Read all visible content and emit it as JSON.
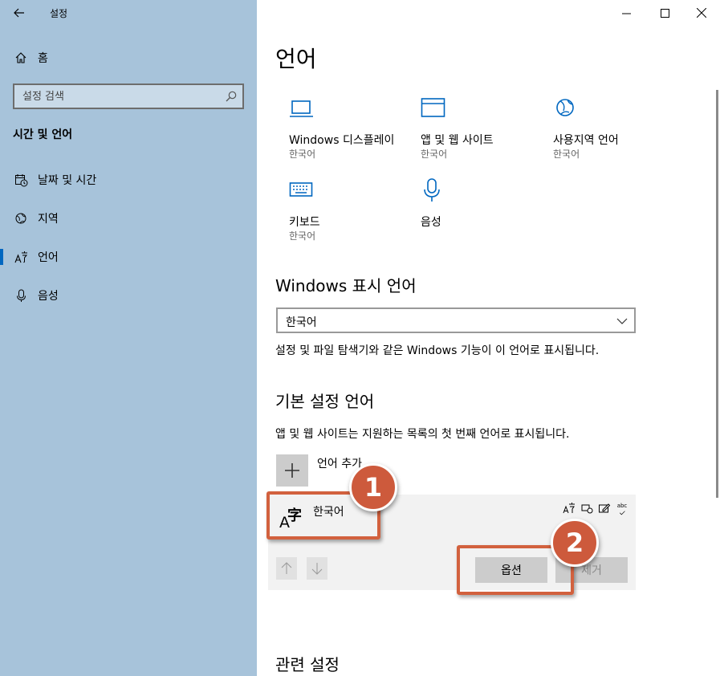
{
  "window": {
    "app_title": "설정"
  },
  "sidebar": {
    "home_label": "홈",
    "search_placeholder": "설정 검색",
    "section_title": "시간 및 언어",
    "items": [
      {
        "label": "날짜 및 시간",
        "icon": "calendar-clock-icon"
      },
      {
        "label": "지역",
        "icon": "globe-pin-icon"
      },
      {
        "label": "언어",
        "icon": "language-icon",
        "active": true
      },
      {
        "label": "음성",
        "icon": "microphone-icon"
      }
    ]
  },
  "main": {
    "title": "언어",
    "tiles": [
      {
        "name": "Windows 디스플레이",
        "sub": "한국어",
        "icon": "laptop-icon"
      },
      {
        "name": "앱 및 웹 사이트",
        "sub": "한국어",
        "icon": "window-icon"
      },
      {
        "name": "사용지역 언어",
        "sub": "한국어",
        "icon": "globe-icon"
      },
      {
        "name": "키보드",
        "sub": "한국어",
        "icon": "keyboard-icon"
      },
      {
        "name": "음성",
        "sub": "",
        "icon": "microphone-icon"
      }
    ],
    "display_language": {
      "heading": "Windows 표시 언어",
      "selected": "한국어",
      "description": "설정 및 파일 탐색기와 같은 Windows 기능이 이 언어로 표시됩니다."
    },
    "preferred": {
      "heading": "기본 설정 언어",
      "description": "앱 및 웹 사이트는 지원하는 목록의 첫 번째 언어로 표시됩니다.",
      "add_label": "언어 추가",
      "language_name": "한국어",
      "options_label": "옵션",
      "remove_label": "제거"
    },
    "related_heading": "관련 설정"
  },
  "annotations": {
    "badge1": "1",
    "badge2": "2",
    "color": "#cd5a3c"
  },
  "language_glyph": "字",
  "language_glyph_a": "A",
  "feature_abc": "abc"
}
